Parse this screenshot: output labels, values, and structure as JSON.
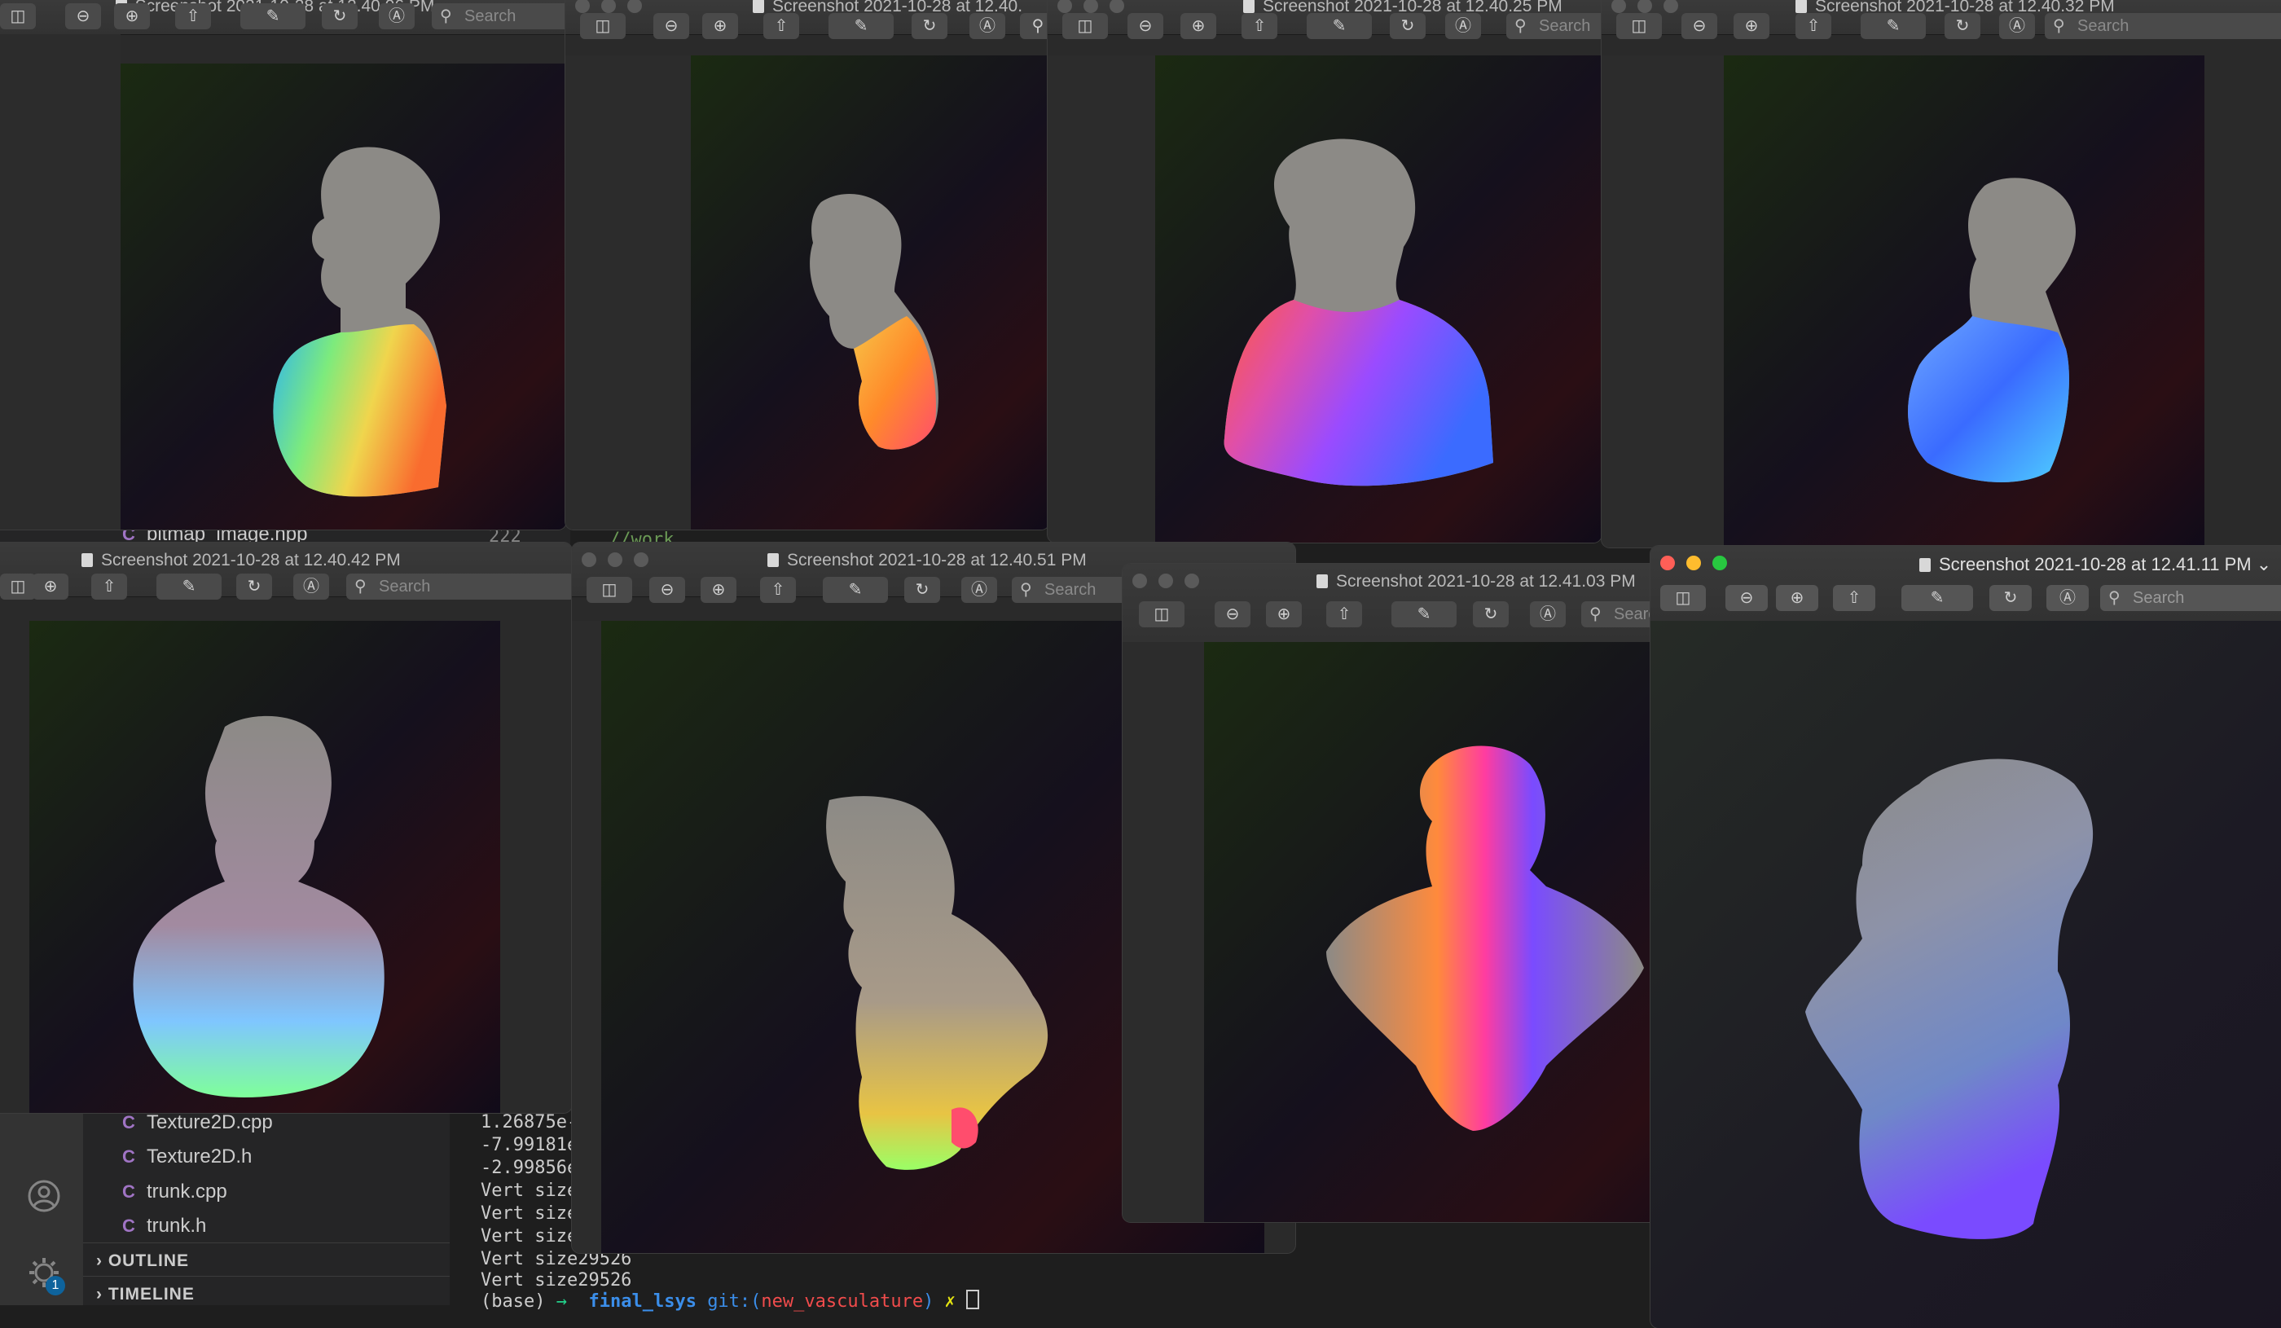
{
  "vscode": {
    "top_file": "bitmap_image.hpp",
    "line_number": "222",
    "code_comment": "//work",
    "files": [
      {
        "name": "Texture2D.cpp",
        "type": "cpp"
      },
      {
        "name": "Texture2D.h",
        "type": "h"
      },
      {
        "name": "trunk.cpp",
        "type": "cpp"
      },
      {
        "name": "trunk.h",
        "type": "h"
      }
    ],
    "sections": [
      "OUTLINE",
      "TIMELINE"
    ],
    "settings_badge": "1",
    "terminal": [
      "1.26875e-",
      "-7.99181e",
      "-2.99856e",
      "Vert size",
      "Vert size",
      "Vert size",
      "Vert size29526",
      "Vert size29526"
    ],
    "prompt": {
      "env": "(base)",
      "arrow": "→",
      "dir": "final_lsys",
      "git_prefix": "git:(",
      "branch": "new_vasculature",
      "git_suffix": ")",
      "dirty": "✗"
    }
  },
  "windows": [
    {
      "id": "w1",
      "title": "Screenshot 2021-10-28 at 12.40.06 PM"
    },
    {
      "id": "w2",
      "title": "Screenshot 2021-10-28 at 12.40."
    },
    {
      "id": "w3",
      "title": "Screenshot 2021-10-28 at 12.40.25 PM"
    },
    {
      "id": "w4",
      "title": "Screenshot 2021-10-28 at 12.40.32 PM"
    },
    {
      "id": "w5",
      "title": "Screenshot 2021-10-28 at 12.40.42 PM"
    },
    {
      "id": "w6",
      "title": "Screenshot 2021-10-28 at 12.40.51 PM"
    },
    {
      "id": "w7",
      "title": "Screenshot 2021-10-28 at 12.41.03 PM"
    },
    {
      "id": "w8",
      "title": "Screenshot 2021-10-28 at 12.41.11 PM"
    }
  ],
  "toolbar": {
    "search_placeholder": "Search",
    "icons": [
      "sidebar-toggle-icon",
      "zoom-out-icon",
      "zoom-in-icon",
      "share-icon",
      "markup-pen-icon",
      "rotate-icon",
      "annotate-icon",
      "search-icon"
    ]
  },
  "colors": {
    "close": "#ff5f57",
    "minimize": "#febc2e",
    "maximize": "#28c840",
    "silhouette": "#8c8a86"
  }
}
